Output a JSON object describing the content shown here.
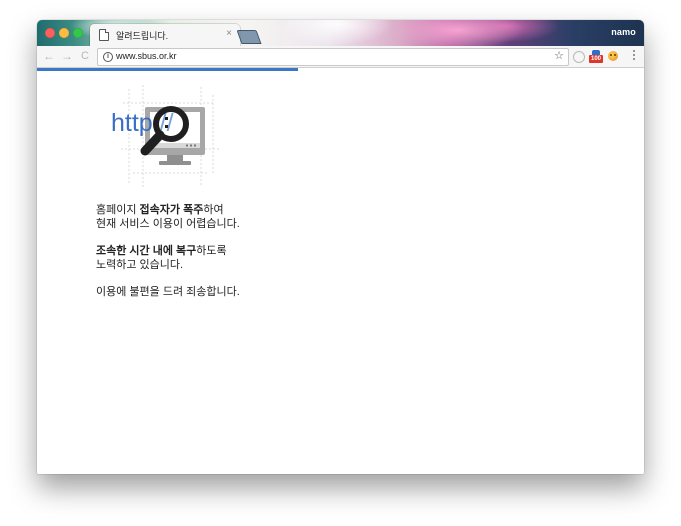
{
  "window": {
    "profile_name": "namo"
  },
  "tab": {
    "title": "알려드립니다.",
    "close_glyph": "×"
  },
  "toolbar": {
    "back_glyph": "←",
    "forward_glyph": "→",
    "reload_glyph": "C",
    "info_glyph": "i",
    "url": "www.sbus.or.kr",
    "star_glyph": "☆",
    "extension_badge": "100"
  },
  "page": {
    "loading_progress_percent": 43,
    "illustration": {
      "text": "http://",
      "icons": [
        "monitor-icon",
        "magnifier-icon"
      ],
      "text_color": "#3a6fc4"
    },
    "message": [
      {
        "lines": [
          [
            {
              "text": "홈페이지 ",
              "bold": false
            },
            {
              "text": "접속자가 폭주",
              "bold": true
            },
            {
              "text": "하여",
              "bold": false
            }
          ],
          [
            {
              "text": "현재 서비스 이용이 어렵습니다.",
              "bold": false
            }
          ]
        ]
      },
      {
        "lines": [
          [
            {
              "text": "조속한 시간 내에 복구",
              "bold": true
            },
            {
              "text": "하도록",
              "bold": false
            }
          ],
          [
            {
              "text": "노력하고 있습니다.",
              "bold": false
            }
          ]
        ]
      },
      {
        "lines": [
          [
            {
              "text": "이용에 불편을 드려 죄송합니다.",
              "bold": false
            }
          ]
        ]
      }
    ]
  },
  "colors": {
    "accent": "#3b78c3",
    "close": "#fc605c",
    "minimize": "#fdbc40",
    "maximize": "#34c84a"
  }
}
